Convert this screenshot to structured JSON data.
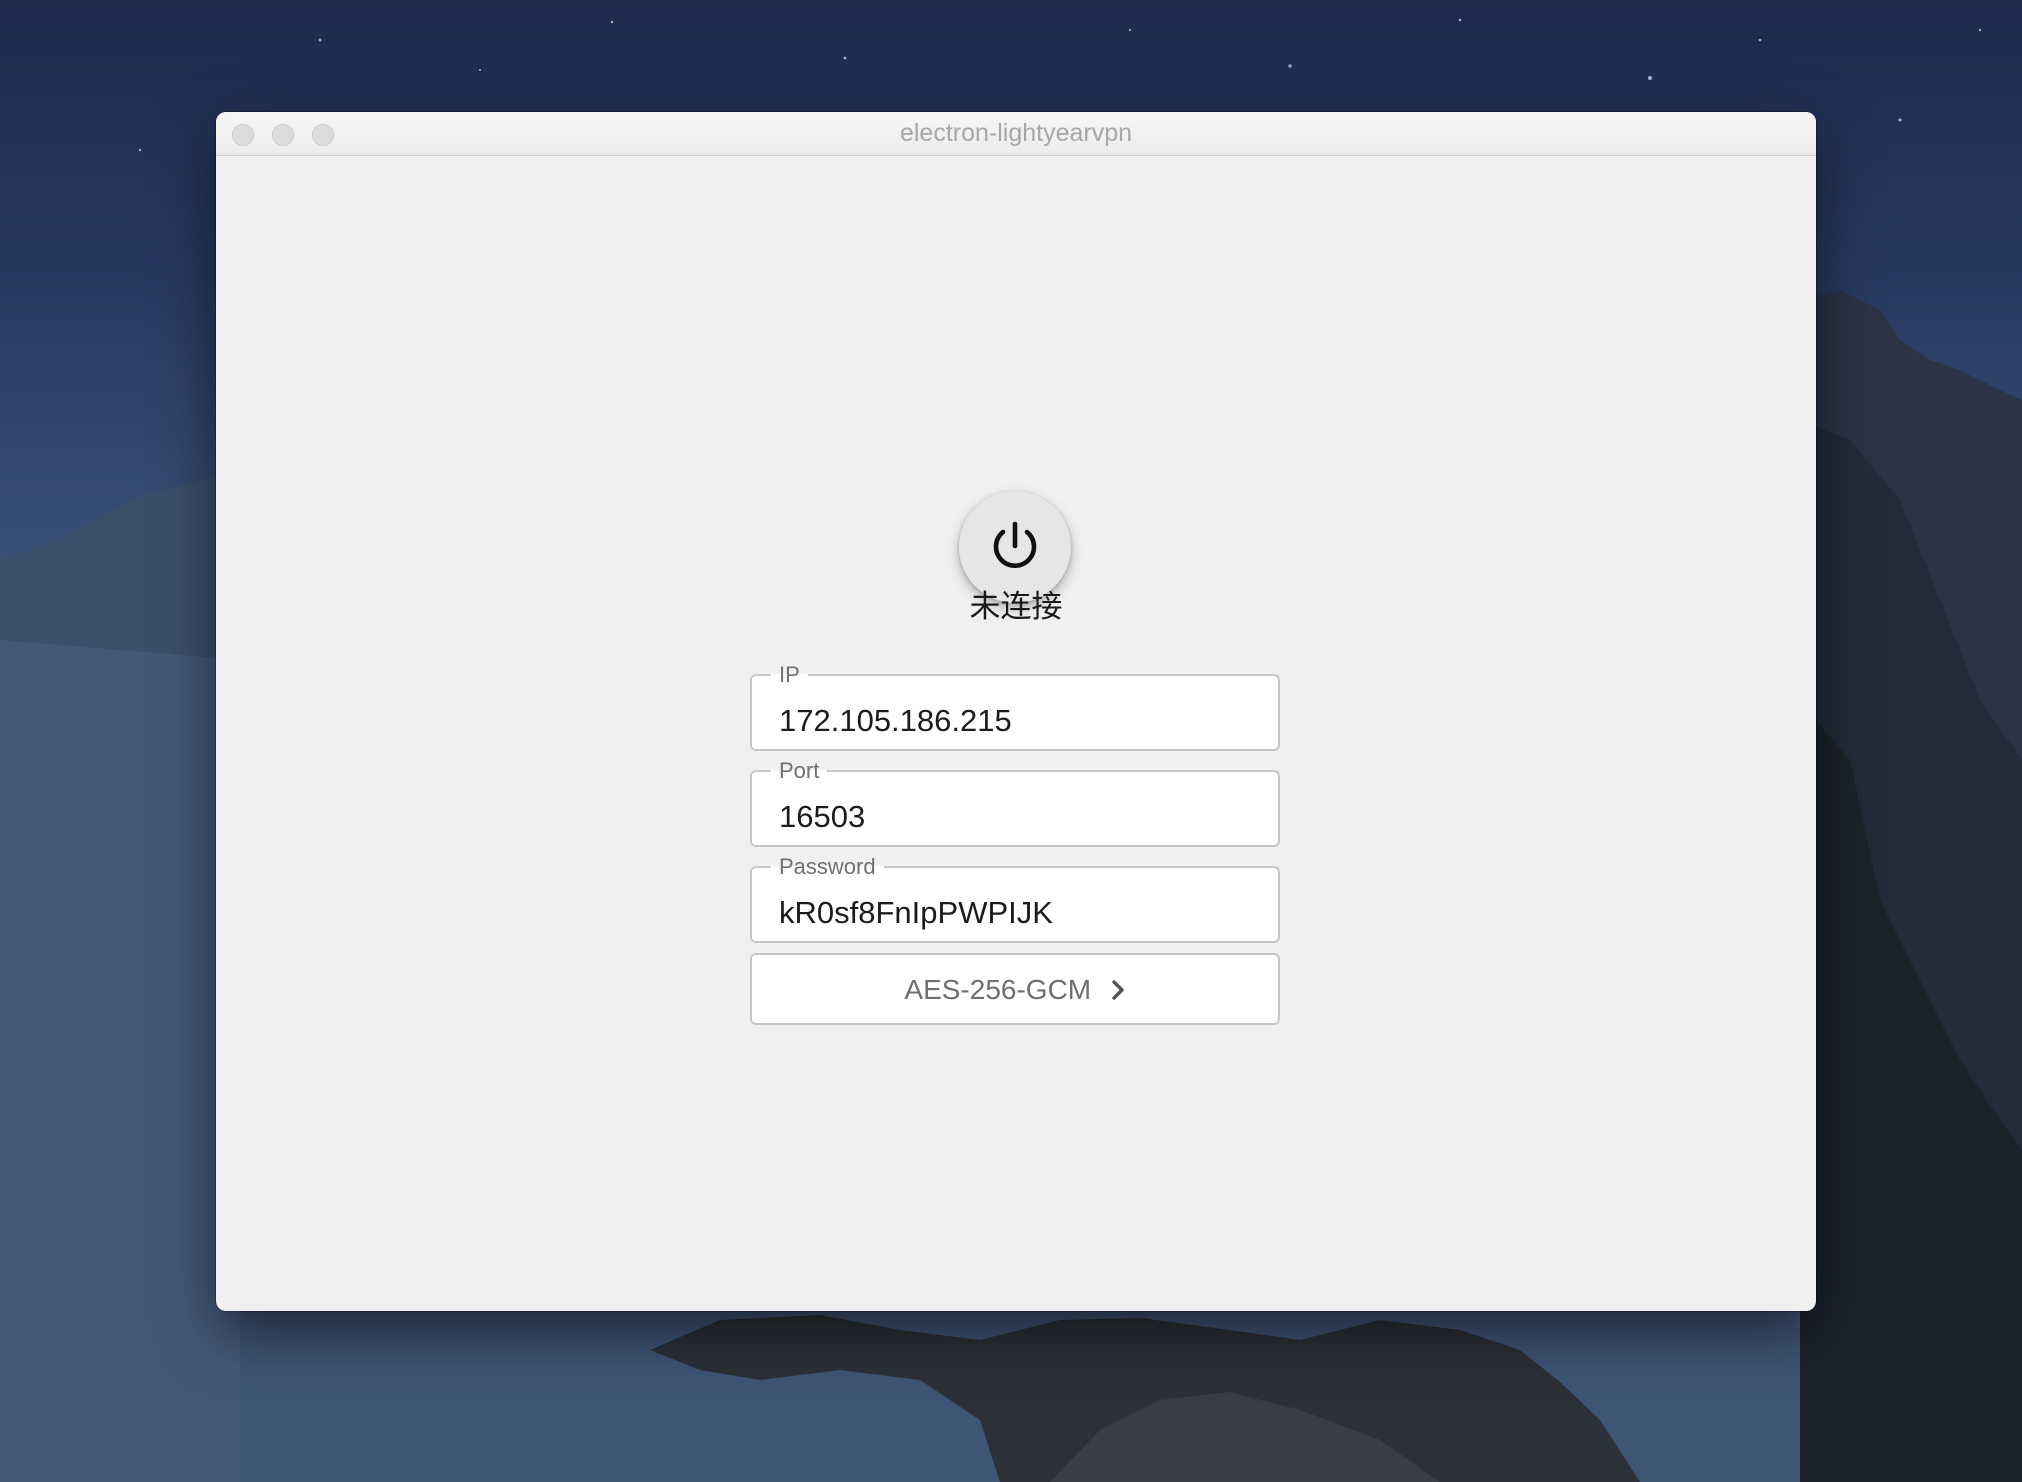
{
  "window": {
    "title": "electron-lightyearvpn"
  },
  "power": {
    "icon": "power-icon",
    "status": "未连接"
  },
  "form": {
    "ip": {
      "label": "IP",
      "value": "172.105.186.215"
    },
    "port": {
      "label": "Port",
      "value": "16503"
    },
    "password": {
      "label": "Password",
      "value": "kR0sf8FnIpPWPIJK"
    },
    "cipher": {
      "label": "AES-256-GCM",
      "icon": "chevron-right-icon"
    }
  },
  "colors": {
    "window_bg": "#f0f0f0",
    "field_border": "#c6c6c6",
    "label": "#707070"
  }
}
